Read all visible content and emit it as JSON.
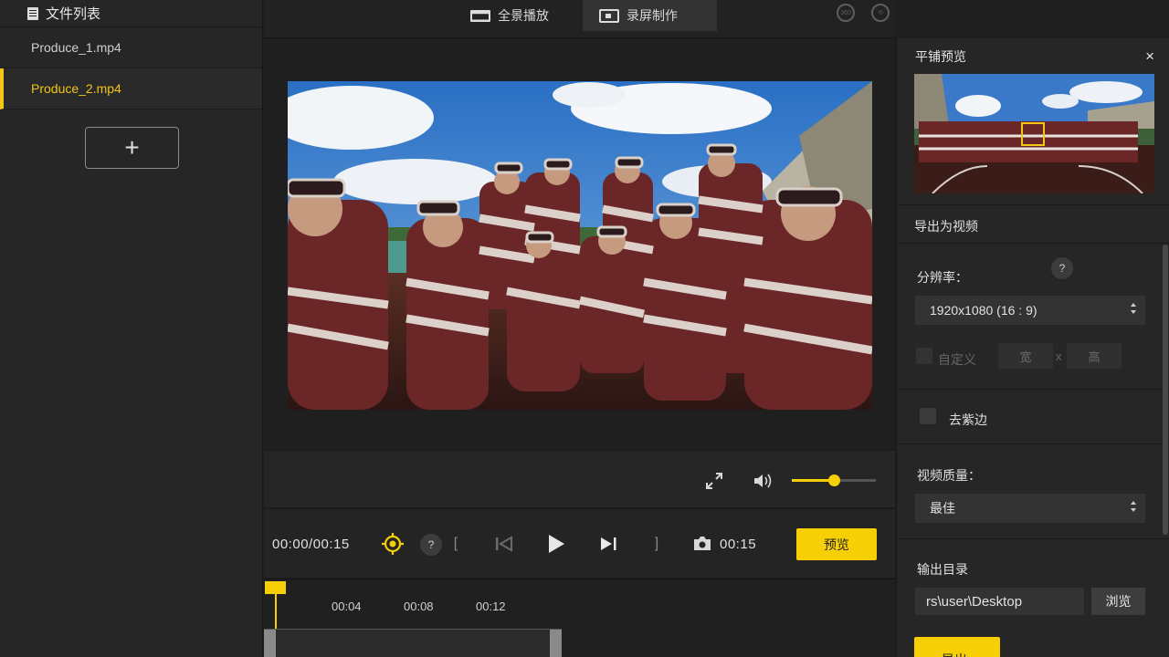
{
  "sidebar": {
    "title": "文件列表",
    "files": [
      "Produce_1.mp4",
      "Produce_2.mp4"
    ],
    "add_label": "+"
  },
  "topbar": {
    "tab_pano": "全景播放",
    "tab_record": "录屏制作"
  },
  "player": {
    "current_time": "00:00/00:15",
    "clip_time": "00:15",
    "preview_label": "预览",
    "help": "?",
    "bracket_in": "[",
    "bracket_out": "]",
    "volume_level": 0.5
  },
  "timeline": {
    "ticks": [
      "00:04",
      "00:08",
      "00:12"
    ]
  },
  "right_panel": {
    "tile_preview_title": "平铺预览",
    "close": "×",
    "export_video_title": "导出为视频",
    "resolution_label": "分辨率：",
    "resolution_help": "?",
    "resolution_value": "1920x1080 (16 : 9)",
    "custom_label": "自定义",
    "width_placeholder": "宽",
    "times": "x",
    "height_placeholder": "高",
    "defringe_label": "去紫边",
    "quality_label": "视频质量：",
    "quality_value": "最佳",
    "output_dir_label": "输出目录",
    "output_dir_value": "rs\\user\\Desktop",
    "browse_label": "浏览",
    "export_label": "导出"
  },
  "colors": {
    "accent": "#f7cf05",
    "panel": "#262626",
    "background": "#1e1e1e"
  }
}
